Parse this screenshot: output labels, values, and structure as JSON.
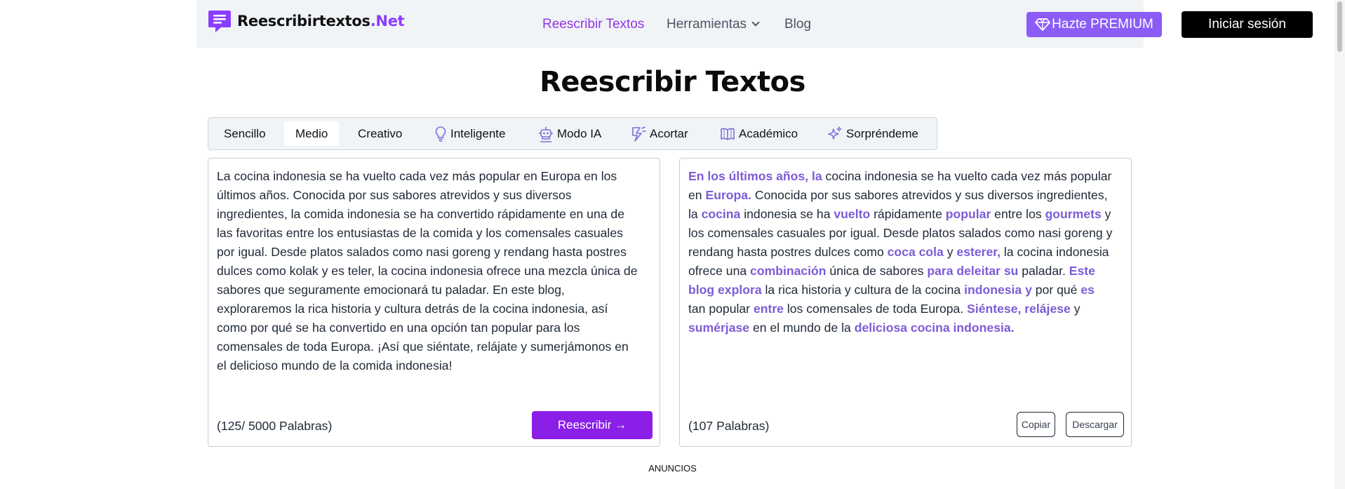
{
  "header": {
    "logo_name": "Reescribirtextos",
    "logo_tld": ".Net",
    "nav": {
      "rewrite": "Reescribir Textos",
      "tools": "Herramientas",
      "blog": "Blog"
    },
    "premium_label": "Hazte PREMIUM",
    "login_label": "Iniciar sesión",
    "colors": {
      "accent": "#9333ea",
      "premium_bg": "#8b5cf6",
      "login_bg": "#000000"
    }
  },
  "page_title": "Reescribir Textos",
  "tabs": {
    "simple": "Sencillo",
    "medium": "Medio",
    "creative": "Creativo",
    "smart": "Inteligente",
    "ai": "Modo IA",
    "shorten": "Acortar",
    "academic": "Académico",
    "surprise": "Sorpréndeme",
    "selected": "Medio"
  },
  "input": {
    "text": "La cocina indonesia se ha vuelto cada vez más popular en Europa en los últimos años. Conocida por sus sabores atrevidos y sus diversos ingredientes, la comida indonesia se ha convertido rápidamente en una de las favoritas entre los entusiastas de la comida y los comensales casuales por igual. Desde platos salados como nasi goreng y rendang hasta postres dulces como kolak y es teler, la cocina indonesia ofrece una mezcla única de sabores que seguramente emocionará tu paladar. En este blog, exploraremos la rica historia y cultura detrás de la cocina indonesia, así como por qué se ha convertido en una opción tan popular para los comensales de toda Europa. ¡Así que siéntate, relájate y sumerjámonos en el delicioso mundo de la comida indonesia!",
    "word_count": "(125/ 5000 Palabras)",
    "rewrite_button": "Reescribir →"
  },
  "output": {
    "segments": [
      {
        "t": "En los últimos años, la",
        "h": true
      },
      {
        "t": " cocina indonesia se ha vuelto cada vez más popular en ",
        "h": false
      },
      {
        "t": "Europa.",
        "h": true
      },
      {
        "t": " Conocida por sus sabores atrevidos y sus diversos ingredientes, la ",
        "h": false
      },
      {
        "t": "cocina",
        "h": true
      },
      {
        "t": " indonesia se ha ",
        "h": false
      },
      {
        "t": "vuelto",
        "h": true
      },
      {
        "t": " rápidamente ",
        "h": false
      },
      {
        "t": "popular",
        "h": true
      },
      {
        "t": " entre los ",
        "h": false
      },
      {
        "t": "gourmets",
        "h": true
      },
      {
        "t": " y los comensales casuales por igual. Desde platos salados como nasi goreng y rendang hasta postres dulces como ",
        "h": false
      },
      {
        "t": "coca cola",
        "h": true
      },
      {
        "t": " y ",
        "h": false
      },
      {
        "t": "esterer,",
        "h": true
      },
      {
        "t": " la cocina indonesia ofrece una ",
        "h": false
      },
      {
        "t": "combinación",
        "h": true
      },
      {
        "t": " única de sabores ",
        "h": false
      },
      {
        "t": "para deleitar su",
        "h": true
      },
      {
        "t": " paladar. ",
        "h": false
      },
      {
        "t": "Este blog explora",
        "h": true
      },
      {
        "t": " la rica historia y cultura de la cocina ",
        "h": false
      },
      {
        "t": "indonesia y",
        "h": true
      },
      {
        "t": " por qué ",
        "h": false
      },
      {
        "t": "es",
        "h": true
      },
      {
        "t": " tan popular ",
        "h": false
      },
      {
        "t": "entre",
        "h": true
      },
      {
        "t": " los comensales de toda Europa. ",
        "h": false
      },
      {
        "t": "Siéntese, relájese",
        "h": true
      },
      {
        "t": " y ",
        "h": false
      },
      {
        "t": "sumérjase",
        "h": true
      },
      {
        "t": " en el mundo de la ",
        "h": false
      },
      {
        "t": "deliciosa cocina indonesia.",
        "h": true
      }
    ],
    "word_count": "(107 Palabras)",
    "copy_button": "Copiar",
    "download_button": "Descargar",
    "highlight_color": "#7c5cd6"
  },
  "ads_label": "ANUNCIOS"
}
